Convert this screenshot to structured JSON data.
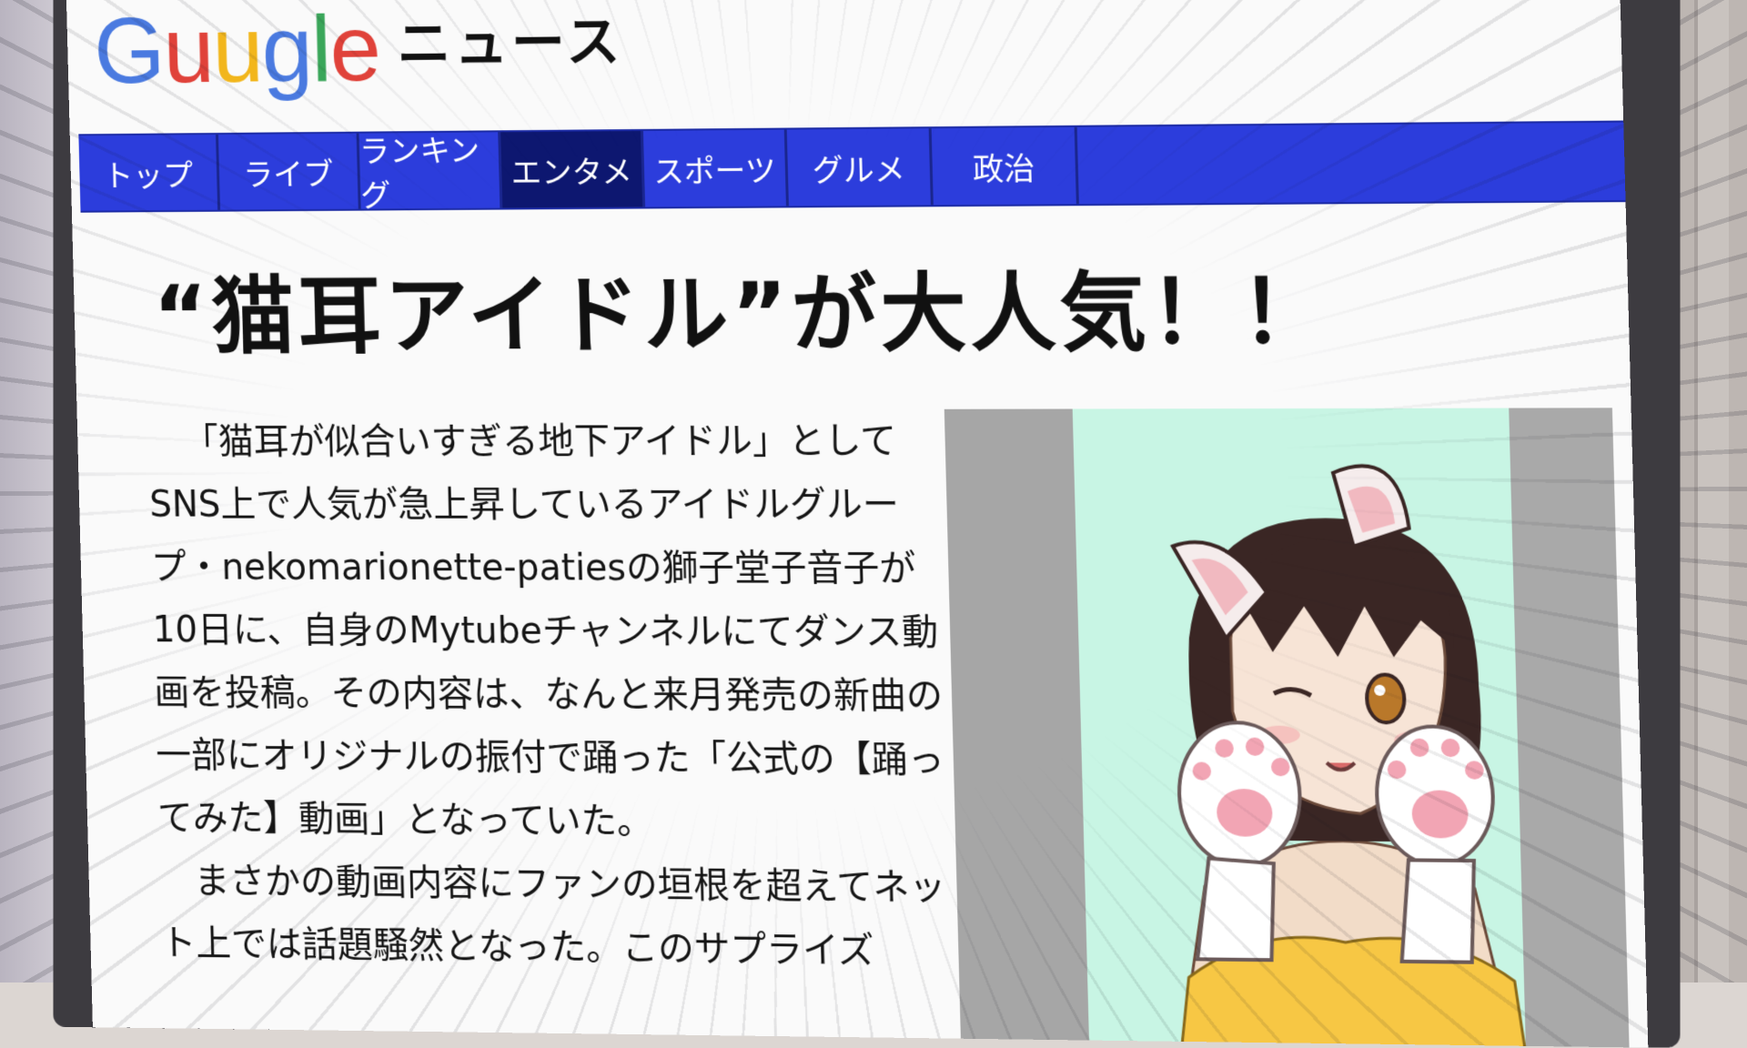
{
  "brand": {
    "logo_letters": [
      {
        "ch": "G",
        "color": "#4a7ae0"
      },
      {
        "ch": "u",
        "color": "#e0423a"
      },
      {
        "ch": "u",
        "color": "#f2b61c"
      },
      {
        "ch": "g",
        "color": "#4a7ae0"
      },
      {
        "ch": "l",
        "color": "#3aa65a"
      },
      {
        "ch": "e",
        "color": "#e0423a"
      }
    ],
    "section_label": "ニュース"
  },
  "nav": {
    "items": [
      {
        "label": "トップ",
        "active": false
      },
      {
        "label": "ライブ",
        "active": false
      },
      {
        "label": "ランキング",
        "active": false
      },
      {
        "label": "エンタメ",
        "active": true
      },
      {
        "label": "スポーツ",
        "active": false
      },
      {
        "label": "グルメ",
        "active": false
      },
      {
        "label": "政治",
        "active": false
      }
    ],
    "bar_color": "#2c3ddc",
    "active_color": "#0d1770"
  },
  "article": {
    "headline": "“猫耳アイドル”が大人気！！",
    "paragraph_1": "「猫耳が似合いすぎる地下アイドル」としてSNS上で人気が急上昇しているアイドルグループ・nekomarionette-patiesの獅子堂子音子が10日に、自身のMytubeチャンネルにてダンス動画を投稿。その内容は、なんと来月発売の新曲の一部にオリジナルの振付で踊った「公式の【踊ってみた】動画」となっていた。",
    "paragraph_2": "まさかの動画内容にファンの垣根を超えてネット上では話題騒然となった。このサプライズ"
  },
  "figure": {
    "icon": "cat-ear-idol-illustration"
  }
}
